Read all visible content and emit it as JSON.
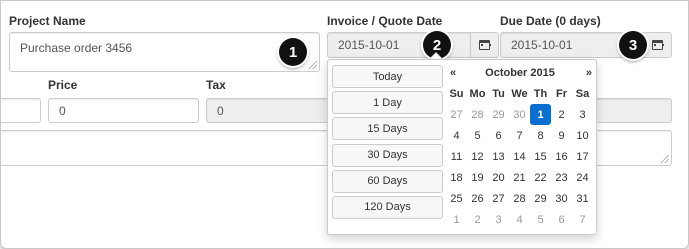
{
  "labels": {
    "project_name": "Project Name",
    "invoice_date": "Invoice / Quote Date",
    "due_date": "Due Date (0 days)",
    "price": "Price",
    "tax": "Tax"
  },
  "fields": {
    "project_name": "Purchase order 3456",
    "invoice_date": "2015-10-01",
    "due_date": "2015-10-01",
    "price": "0",
    "tax": "0"
  },
  "badges": [
    "1",
    "2",
    "3"
  ],
  "icons": {
    "date_addon": "calendar-icon"
  },
  "date_ranges": [
    "Today",
    "1 Day",
    "15 Days",
    "30 Days",
    "60 Days",
    "120 Days"
  ],
  "calendar": {
    "prev": "«",
    "month_year": "October 2015",
    "next": "»",
    "weekdays": [
      "Su",
      "Mo",
      "Tu",
      "We",
      "Th",
      "Fr",
      "Sa"
    ],
    "weeks": [
      [
        "27",
        "28",
        "29",
        "30",
        "1",
        "2",
        "3"
      ],
      [
        "4",
        "5",
        "6",
        "7",
        "8",
        "9",
        "10"
      ],
      [
        "11",
        "12",
        "13",
        "14",
        "15",
        "16",
        "17"
      ],
      [
        "18",
        "19",
        "20",
        "21",
        "22",
        "23",
        "24"
      ],
      [
        "25",
        "26",
        "27",
        "28",
        "29",
        "30",
        "31"
      ],
      [
        "1",
        "2",
        "3",
        "4",
        "5",
        "6",
        "7"
      ]
    ],
    "selected": "1"
  },
  "colors": {
    "accent": "#0a6fd1",
    "badge": "#111111",
    "disabled_bg": "#eeeeee"
  }
}
